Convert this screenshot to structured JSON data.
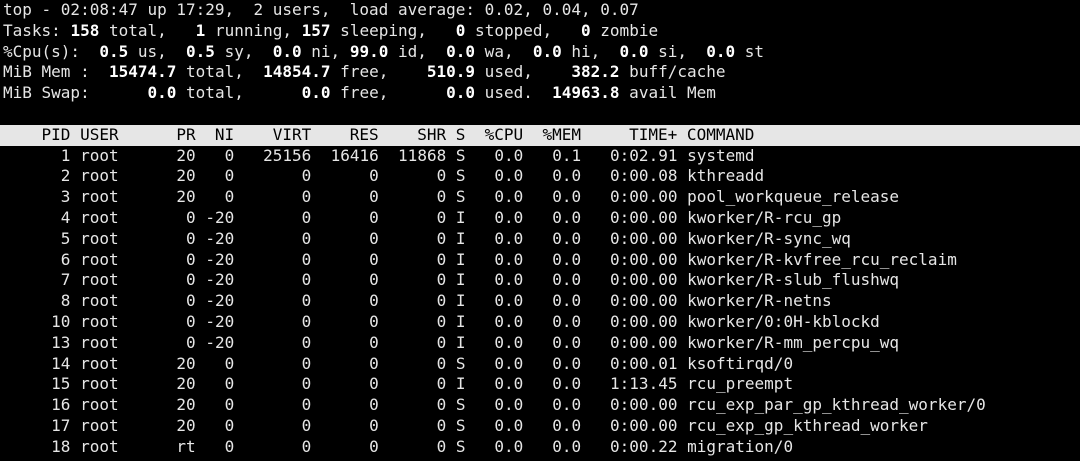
{
  "summary": {
    "uptime_line": "top - 02:08:47 up 17:29,  2 users,  load average: 0.02, 0.04, 0.07",
    "tasks": {
      "label": "Tasks:",
      "total": "158",
      "running": "1",
      "sleeping": "157",
      "stopped": "0",
      "zombie": "0"
    },
    "cpu": {
      "label": "%Cpu(s):",
      "us": "0.5",
      "sy": "0.5",
      "ni": "0.0",
      "id": "99.0",
      "wa": "0.0",
      "hi": "0.0",
      "si": "0.0",
      "st": "0.0"
    },
    "mem": {
      "label": "MiB Mem :",
      "total": "15474.7",
      "free": "14854.7",
      "used": "510.9",
      "buff_cache": "382.2"
    },
    "swap": {
      "label": "MiB Swap:",
      "total": "0.0",
      "free": "0.0",
      "used": "0.0",
      "avail": "14963.8"
    }
  },
  "table": {
    "header": "    PID USER      PR  NI    VIRT    RES    SHR S  %CPU  %MEM     TIME+ COMMAND",
    "rows": [
      {
        "pid": "1",
        "user": "root",
        "pr": "20",
        "ni": "0",
        "virt": "25156",
        "res": "16416",
        "shr": "11868",
        "s": "S",
        "cpu": "0.0",
        "mem": "0.1",
        "time": "0:02.91",
        "command": "systemd"
      },
      {
        "pid": "2",
        "user": "root",
        "pr": "20",
        "ni": "0",
        "virt": "0",
        "res": "0",
        "shr": "0",
        "s": "S",
        "cpu": "0.0",
        "mem": "0.0",
        "time": "0:00.08",
        "command": "kthreadd"
      },
      {
        "pid": "3",
        "user": "root",
        "pr": "20",
        "ni": "0",
        "virt": "0",
        "res": "0",
        "shr": "0",
        "s": "S",
        "cpu": "0.0",
        "mem": "0.0",
        "time": "0:00.00",
        "command": "pool_workqueue_release"
      },
      {
        "pid": "4",
        "user": "root",
        "pr": "0",
        "ni": "-20",
        "virt": "0",
        "res": "0",
        "shr": "0",
        "s": "I",
        "cpu": "0.0",
        "mem": "0.0",
        "time": "0:00.00",
        "command": "kworker/R-rcu_gp"
      },
      {
        "pid": "5",
        "user": "root",
        "pr": "0",
        "ni": "-20",
        "virt": "0",
        "res": "0",
        "shr": "0",
        "s": "I",
        "cpu": "0.0",
        "mem": "0.0",
        "time": "0:00.00",
        "command": "kworker/R-sync_wq"
      },
      {
        "pid": "6",
        "user": "root",
        "pr": "0",
        "ni": "-20",
        "virt": "0",
        "res": "0",
        "shr": "0",
        "s": "I",
        "cpu": "0.0",
        "mem": "0.0",
        "time": "0:00.00",
        "command": "kworker/R-kvfree_rcu_reclaim"
      },
      {
        "pid": "7",
        "user": "root",
        "pr": "0",
        "ni": "-20",
        "virt": "0",
        "res": "0",
        "shr": "0",
        "s": "I",
        "cpu": "0.0",
        "mem": "0.0",
        "time": "0:00.00",
        "command": "kworker/R-slub_flushwq"
      },
      {
        "pid": "8",
        "user": "root",
        "pr": "0",
        "ni": "-20",
        "virt": "0",
        "res": "0",
        "shr": "0",
        "s": "I",
        "cpu": "0.0",
        "mem": "0.0",
        "time": "0:00.00",
        "command": "kworker/R-netns"
      },
      {
        "pid": "10",
        "user": "root",
        "pr": "0",
        "ni": "-20",
        "virt": "0",
        "res": "0",
        "shr": "0",
        "s": "I",
        "cpu": "0.0",
        "mem": "0.0",
        "time": "0:00.00",
        "command": "kworker/0:0H-kblockd"
      },
      {
        "pid": "13",
        "user": "root",
        "pr": "0",
        "ni": "-20",
        "virt": "0",
        "res": "0",
        "shr": "0",
        "s": "I",
        "cpu": "0.0",
        "mem": "0.0",
        "time": "0:00.00",
        "command": "kworker/R-mm_percpu_wq"
      },
      {
        "pid": "14",
        "user": "root",
        "pr": "20",
        "ni": "0",
        "virt": "0",
        "res": "0",
        "shr": "0",
        "s": "S",
        "cpu": "0.0",
        "mem": "0.0",
        "time": "0:00.01",
        "command": "ksoftirqd/0"
      },
      {
        "pid": "15",
        "user": "root",
        "pr": "20",
        "ni": "0",
        "virt": "0",
        "res": "0",
        "shr": "0",
        "s": "I",
        "cpu": "0.0",
        "mem": "0.0",
        "time": "1:13.45",
        "command": "rcu_preempt"
      },
      {
        "pid": "16",
        "user": "root",
        "pr": "20",
        "ni": "0",
        "virt": "0",
        "res": "0",
        "shr": "0",
        "s": "S",
        "cpu": "0.0",
        "mem": "0.0",
        "time": "0:00.00",
        "command": "rcu_exp_par_gp_kthread_worker/0"
      },
      {
        "pid": "17",
        "user": "root",
        "pr": "20",
        "ni": "0",
        "virt": "0",
        "res": "0",
        "shr": "0",
        "s": "S",
        "cpu": "0.0",
        "mem": "0.0",
        "time": "0:00.00",
        "command": "rcu_exp_gp_kthread_worker"
      },
      {
        "pid": "18",
        "user": "root",
        "pr": "rt",
        "ni": "0",
        "virt": "0",
        "res": "0",
        "shr": "0",
        "s": "S",
        "cpu": "0.0",
        "mem": "0.0",
        "time": "0:00.22",
        "command": "migration/0"
      }
    ]
  }
}
